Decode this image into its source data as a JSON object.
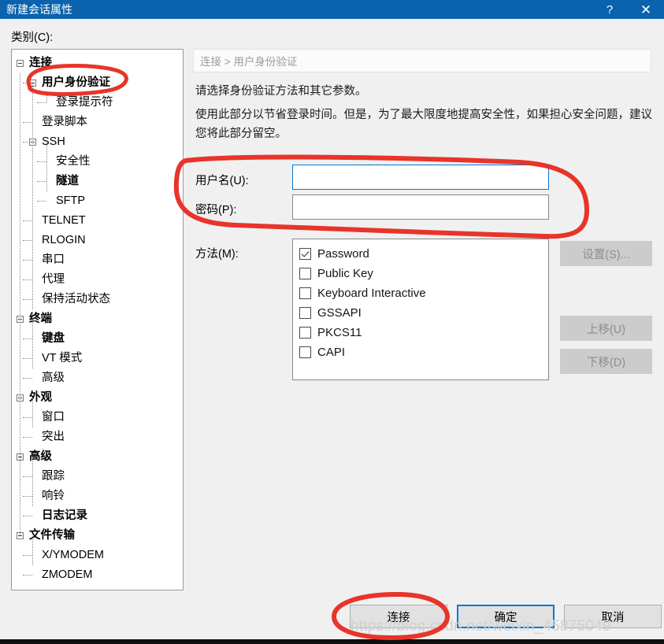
{
  "window": {
    "title": "新建会话属性",
    "help_icon": "?",
    "close_icon": "✕"
  },
  "category_label": "类别(C):",
  "tree": {
    "nodes": [
      {
        "label": "连接",
        "depth": 0,
        "bold": true,
        "expander": "minus"
      },
      {
        "label": "用户身份验证",
        "depth": 1,
        "bold": true,
        "expander": "minus"
      },
      {
        "label": "登录提示符",
        "depth": 2,
        "bold": false,
        "expander": "none"
      },
      {
        "label": "登录脚本",
        "depth": 1,
        "bold": false,
        "expander": "none"
      },
      {
        "label": "SSH",
        "depth": 1,
        "bold": false,
        "expander": "minus"
      },
      {
        "label": "安全性",
        "depth": 2,
        "bold": false,
        "expander": "none"
      },
      {
        "label": "隧道",
        "depth": 2,
        "bold": true,
        "expander": "none"
      },
      {
        "label": "SFTP",
        "depth": 2,
        "bold": false,
        "expander": "none"
      },
      {
        "label": "TELNET",
        "depth": 1,
        "bold": false,
        "expander": "none"
      },
      {
        "label": "RLOGIN",
        "depth": 1,
        "bold": false,
        "expander": "none"
      },
      {
        "label": "串口",
        "depth": 1,
        "bold": false,
        "expander": "none"
      },
      {
        "label": "代理",
        "depth": 1,
        "bold": false,
        "expander": "none"
      },
      {
        "label": "保持活动状态",
        "depth": 1,
        "bold": false,
        "expander": "none"
      },
      {
        "label": "终端",
        "depth": 0,
        "bold": true,
        "expander": "minus"
      },
      {
        "label": "键盘",
        "depth": 1,
        "bold": true,
        "expander": "none"
      },
      {
        "label": "VT 模式",
        "depth": 1,
        "bold": false,
        "expander": "none"
      },
      {
        "label": "高级",
        "depth": 1,
        "bold": false,
        "expander": "none"
      },
      {
        "label": "外观",
        "depth": 0,
        "bold": true,
        "expander": "minus"
      },
      {
        "label": "窗口",
        "depth": 1,
        "bold": false,
        "expander": "none"
      },
      {
        "label": "突出",
        "depth": 1,
        "bold": false,
        "expander": "none"
      },
      {
        "label": "高级",
        "depth": 0,
        "bold": true,
        "expander": "minus"
      },
      {
        "label": "跟踪",
        "depth": 1,
        "bold": false,
        "expander": "none"
      },
      {
        "label": "响铃",
        "depth": 1,
        "bold": false,
        "expander": "none"
      },
      {
        "label": "日志记录",
        "depth": 1,
        "bold": true,
        "expander": "none"
      },
      {
        "label": "文件传输",
        "depth": 0,
        "bold": true,
        "expander": "minus"
      },
      {
        "label": "X/YMODEM",
        "depth": 1,
        "bold": false,
        "expander": "none"
      },
      {
        "label": "ZMODEM",
        "depth": 1,
        "bold": false,
        "expander": "none"
      }
    ]
  },
  "panel": {
    "breadcrumb": "连接 > 用户身份验证",
    "description_line1": "请选择身份验证方法和其它参数。",
    "description_line2": "使用此部分以节省登录时间。但是，为了最大限度地提高安全性，如果担心安全问题，建议您将此部分留空。",
    "username": {
      "label": "用户名(U):",
      "value": "",
      "placeholder": ""
    },
    "password": {
      "label": "密码(P):",
      "value": "",
      "placeholder": ""
    },
    "method": {
      "label": "方法(M):",
      "items": [
        {
          "label": "Password",
          "checked": true
        },
        {
          "label": "Public Key",
          "checked": false
        },
        {
          "label": "Keyboard Interactive",
          "checked": false
        },
        {
          "label": "GSSAPI",
          "checked": false
        },
        {
          "label": "PKCS11",
          "checked": false
        },
        {
          "label": "CAPI",
          "checked": false
        }
      ]
    },
    "side_buttons": [
      {
        "label": "设置(S)...",
        "disabled": true
      },
      {
        "label": "上移(U)",
        "disabled": true
      },
      {
        "label": "下移(D)",
        "disabled": true
      }
    ]
  },
  "footer": {
    "buttons": [
      {
        "label": "连接",
        "default": false
      },
      {
        "label": "确定",
        "default": true
      },
      {
        "label": "取消",
        "default": false
      }
    ]
  },
  "watermark": "https://blog.csdn.net/weixin_45875049",
  "colors": {
    "titlebar": "#0a63ac",
    "dialog_bg": "#f0f0f0",
    "accent": "#0078d7",
    "annotation": "#e8342a"
  }
}
